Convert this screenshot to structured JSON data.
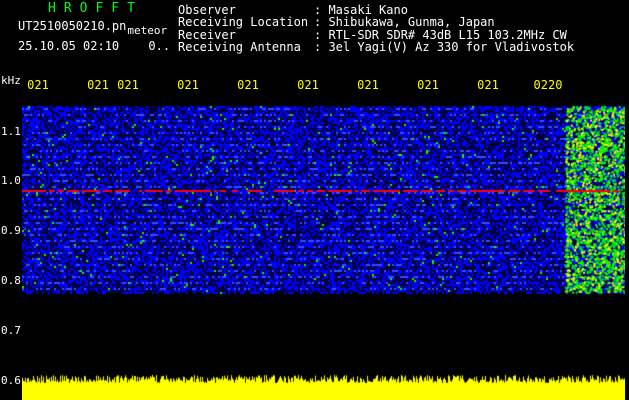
{
  "header": {
    "app_title": "HROFFT",
    "app_title_color": "#00ff00",
    "file_name": "UT2510050210.pn",
    "file_suffix": "meteor",
    "datetime": "25.10.05 02:10",
    "count": "0..",
    "info": [
      {
        "label": "Observer",
        "value": ": Masaki Kano"
      },
      {
        "label": "Receiving Location",
        "value": ": Shibukawa, Gunma, Japan"
      },
      {
        "label": "Receiver",
        "value": ": RTL-SDR SDR# 43dB L15 103.2MHz CW"
      },
      {
        "label": "Receiving Antenna",
        "value": ": 3el Yagi(V) Az 330 for Vladivostok"
      }
    ]
  },
  "time_axis": {
    "labels": [
      "021",
      "021",
      "021",
      "021",
      "021",
      "021",
      "021",
      "021",
      "021",
      "0220"
    ],
    "color": "#ffff00"
  },
  "freq_axis": {
    "unit": "kHz",
    "labels": [
      "1.1",
      "1.0",
      "0.9",
      "0.8",
      "0.7",
      "0.6"
    ]
  },
  "spectrogram": {
    "min_khz": 0.75,
    "max_khz": 1.06,
    "red_line_khz": 0.92,
    "background": "#000040",
    "noise_color": "#0000ff",
    "signal_color": "#00ff00",
    "peak_color": "#ff0000"
  },
  "meter": {
    "color": "#ffff00",
    "level": 0.7
  }
}
